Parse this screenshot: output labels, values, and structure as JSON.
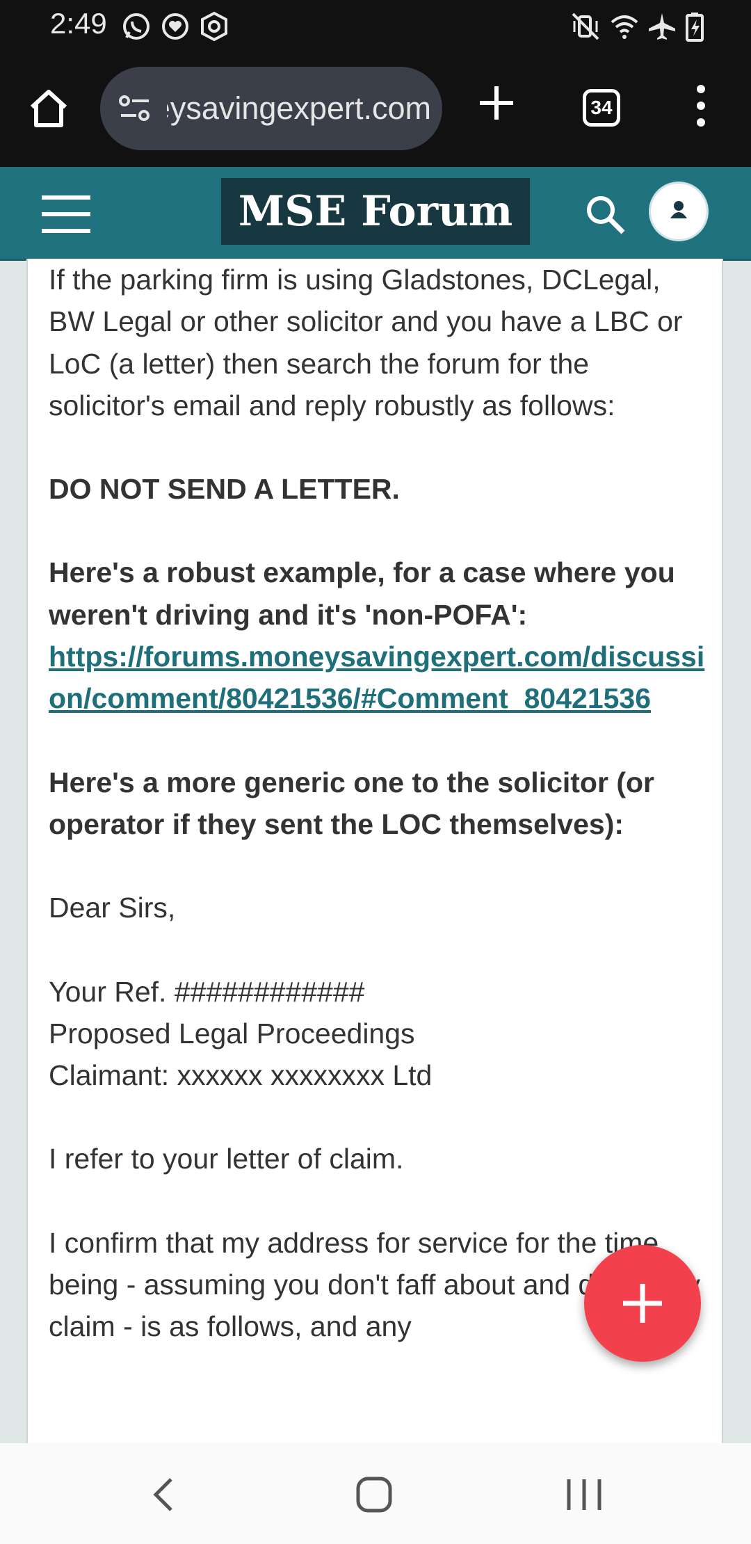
{
  "status_bar": {
    "time": "2:49",
    "left_icons": [
      "whatsapp-icon",
      "heart-chat-icon",
      "hexagon-icon"
    ],
    "right_icons": [
      "vibrate-mute-icon",
      "wifi-icon",
      "airplane-icon",
      "battery-icon"
    ]
  },
  "browser": {
    "url": "moneysavingexpert.com",
    "tab_count": "34"
  },
  "site": {
    "logo_text": "MSE Forum"
  },
  "post": {
    "paragraphs": {
      "p1": "If the parking firm is using Gladstones, DCLegal, BW Legal or other solicitor and you have a LBC or LoC (a letter) then search the forum for the solicitor's email and reply robustly as follows:",
      "p2": "DO NOT SEND A LETTER.",
      "p3": "Here's a robust example, for a case where you weren't driving and it's 'non-POFA':",
      "link": "https://forums.moneysavingexpert.com/discussion/comment/80421536/#Comment_80421536",
      "p4": "Here's a more generic one to the solicitor (or operator if they sent the LOC themselves):",
      "p5": "Dear Sirs,",
      "ref_line": "Your Ref. ############",
      "proceedings_line": "Proposed Legal Proceedings",
      "claimant_line": "Claimant: xxxxxx xxxxxxxx Ltd",
      "p7": "I refer to your letter of claim.",
      "p8": "I confirm that my address for service for the time being - assuming you don't faff about and delay any claim - is as follows, and any"
    }
  },
  "colors": {
    "site_header": "#21727f",
    "logo_bg": "#173840",
    "link": "#1e6f7a",
    "fab": "#f2414c"
  }
}
